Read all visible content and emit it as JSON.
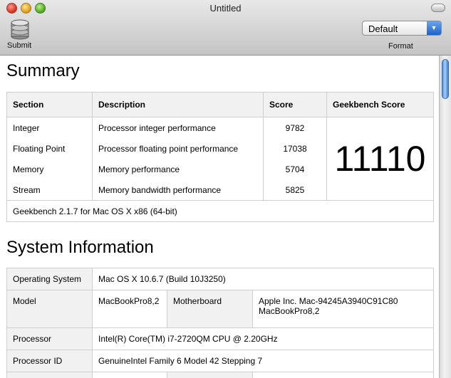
{
  "window": {
    "title": "Untitled"
  },
  "toolbar": {
    "submit_label": "Submit",
    "format_value": "Default",
    "format_label": "Format"
  },
  "summary": {
    "heading": "Summary",
    "headers": {
      "section": "Section",
      "description": "Description",
      "score": "Score",
      "geekbench": "Geekbench Score"
    },
    "rows": [
      {
        "section": "Integer",
        "description": "Processor integer performance",
        "score": "9782"
      },
      {
        "section": "Floating Point",
        "description": "Processor floating point performance",
        "score": "17038"
      },
      {
        "section": "Memory",
        "description": "Memory performance",
        "score": "5704"
      },
      {
        "section": "Stream",
        "description": "Memory bandwidth performance",
        "score": "5825"
      }
    ],
    "geekbench_score": "11110",
    "footer": "Geekbench 2.1.7 for Mac OS X x86 (64-bit)"
  },
  "system": {
    "heading": "System Information",
    "os_label": "Operating System",
    "os_value": "Mac OS X 10.6.7 (Build 10J3250)",
    "model_label": "Model",
    "model_value": "MacBookPro8,2",
    "motherboard_label": "Motherboard",
    "motherboard_value_line1": "Apple Inc. Mac-94245A3940C91C80",
    "motherboard_value_line2": "MacBookPro8,2",
    "processor_label": "Processor",
    "processor_value": "Intel(R) Core(TM) i7-2720QM CPU @ 2.20GHz",
    "processor_id_label": "Processor ID",
    "processor_id_value": "GenuineIntel Family 6 Model 42 Stepping 7"
  },
  "colors": {
    "accent": "#1e62c8",
    "table_border": "#cfcfcf",
    "header_bg": "#f1f1f1"
  },
  "icons": {
    "submit": "database-icon",
    "format_arrow": "chevron-down-icon"
  }
}
